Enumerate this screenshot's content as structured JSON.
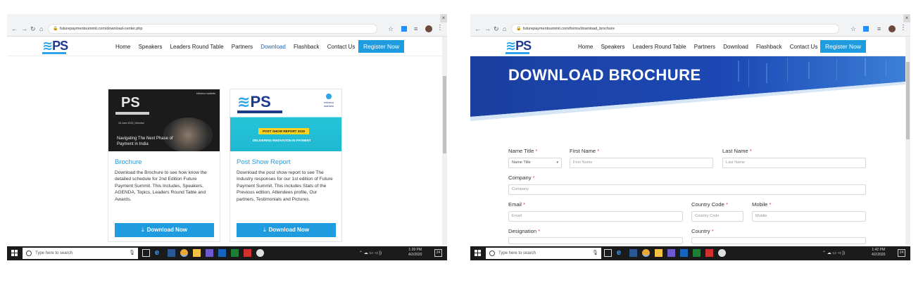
{
  "left": {
    "url": "futurepaymentsummit.com/download-center.php",
    "nav": {
      "home": "Home",
      "speakers": "Speakers",
      "leaders": "Leaders Round Table",
      "partners": "Partners",
      "download": "Download",
      "flashback": "Flashback",
      "contact": "Contact Us",
      "register": "Register Now"
    },
    "cards": [
      {
        "title": "Brochure",
        "image_text": "Navigating The Next Phase of Payment in India",
        "image_date": "18 June 2020 | Mumbai",
        "image_badge": "informa markets",
        "description": "Download the Brochure to see how know the detailed schedule for 2nd Edition Future Payment Summit. This Includes, Speakers, AGENDA, Topics, Leaders Round Table and Awards.",
        "button": "Download Now"
      },
      {
        "title": "Post Show Report",
        "image_pill": "POST SHOW REPORT 2019",
        "image_tag": "DELIVERING INNOVATION IN PAYMENT",
        "image_badge": "informa markets",
        "description": "Download the post show report to see The Industry responses for our 1st edition of Future Payment Summit. This includes Stats of the Previous edition, Attendees profile, Our partners, Testimonials and Pictures.",
        "button": "Download Now"
      }
    ],
    "taskbar": {
      "search_placeholder": "Type here to search",
      "time": "1:39 PM",
      "date": "4/2/2020",
      "notifications": "24"
    }
  },
  "right": {
    "url": "futurepaymentsummit.com/forms/download_brochure",
    "nav": {
      "home": "Home",
      "speakers": "Speakers",
      "leaders": "Leaders Round Table",
      "partners": "Partners",
      "download": "Download",
      "flashback": "Flashback",
      "contact": "Contact Us",
      "register": "Register Now"
    },
    "banner_title": "DOWNLOAD BROCHURE",
    "form": {
      "name_title_label": "Name Title",
      "name_title_value": "Name Title",
      "first_name_label": "First Name",
      "first_name_placeholder": "First Name",
      "last_name_label": "Last Name",
      "last_name_placeholder": "Last Name",
      "company_label": "Company",
      "company_placeholder": "Company",
      "email_label": "Email",
      "email_placeholder": "Email",
      "country_code_label": "Country Code",
      "country_code_placeholder": "Country Code",
      "mobile_label": "Mobile",
      "mobile_placeholder": "Mobile",
      "designation_label": "Designation",
      "country_label": "Country",
      "required_mark": "*"
    },
    "taskbar": {
      "search_placeholder": "Type here to search",
      "time": "1:42 PM",
      "date": "4/2/2020",
      "notifications": "24"
    }
  },
  "logo_text": "PS",
  "colors": {
    "accent": "#1f9be0",
    "brand_navy": "#1e3a8a",
    "banner_blue": "#1a3fa0",
    "required": "#e53935"
  }
}
